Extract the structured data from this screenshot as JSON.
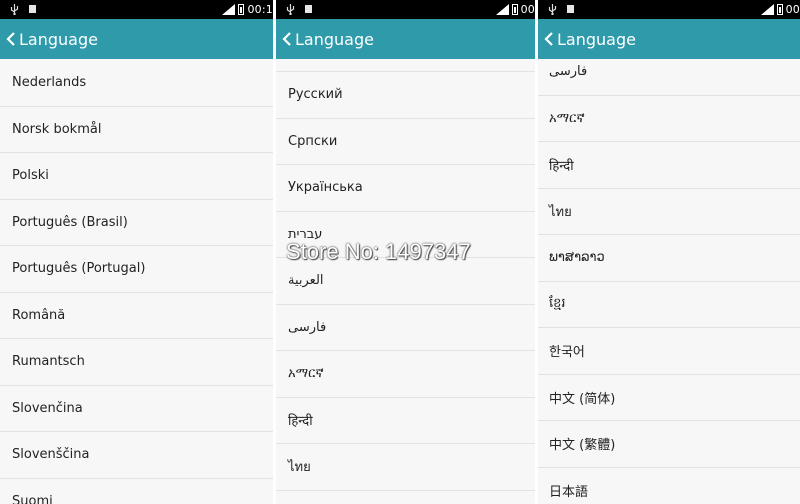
{
  "panels": [
    {
      "status": {
        "clock": "00:1"
      },
      "header": {
        "title": "Language"
      },
      "items": [
        "Nederlands",
        "Norsk bokmål",
        "Polski",
        "Português (Brasil)",
        "Português (Portugal)",
        "Română",
        "Rumantsch",
        "Slovenčina",
        "Slovenščina",
        "Suomi"
      ]
    },
    {
      "status": {
        "clock": "00"
      },
      "header": {
        "title": "Language"
      },
      "items": [
        "Русский",
        "Српски",
        "Українська",
        "עברית",
        "العربية",
        "فارسی",
        "አማርኛ",
        "हिन्दी",
        "ไทย"
      ]
    },
    {
      "status": {
        "clock": "00"
      },
      "header": {
        "title": "Language"
      },
      "items": [
        "فارسی",
        "አማርኛ",
        "हिन्दी",
        "ไทย",
        "ພາສາລາວ",
        "ខ្មែរ",
        "한국어",
        "中文 (简体)",
        "中文 (繁體)",
        "日本語"
      ]
    }
  ],
  "watermark": "Store No: 1497347",
  "colors": {
    "header": "#2e9aaa",
    "statusbar": "#000000",
    "list_bg": "#f7f7f7",
    "divider": "#e2e2e2"
  },
  "icons": {
    "back": "chevron-left-icon",
    "usb": "usb-icon",
    "signal": "signal-icon",
    "battery": "battery-icon"
  }
}
